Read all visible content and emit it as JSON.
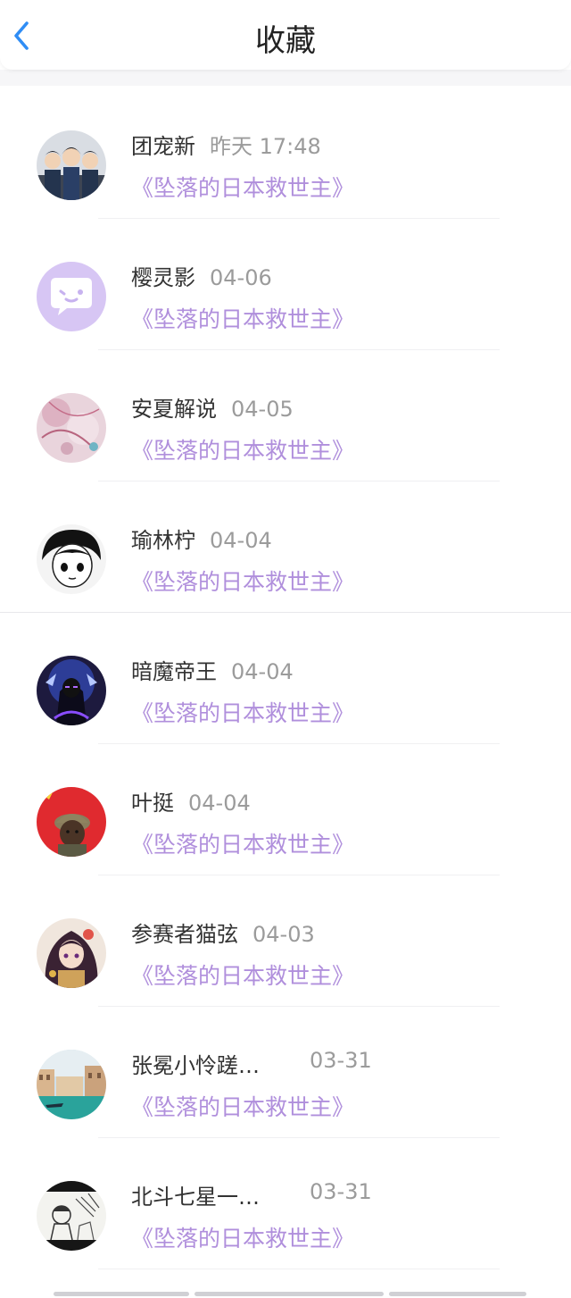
{
  "header": {
    "title": "收藏",
    "back_icon": "chevron-left-icon",
    "accent": "#2f8df5"
  },
  "colors": {
    "work_title": "#b08fdc",
    "timestamp": "#9b9b9b",
    "name": "#333333"
  },
  "items": [
    {
      "name": "团宠新",
      "time": "昨天 17:48",
      "work": "《坠落的日本救世主》",
      "avatar": "anime-trio-avatar"
    },
    {
      "name": "樱灵影",
      "time": "04-06",
      "work": "《坠落的日本救世主》",
      "avatar": "chat-bubble-avatar"
    },
    {
      "name": "安夏解说",
      "time": "04-05",
      "work": "《坠落的日本救世主》",
      "avatar": "pink-abstract-avatar"
    },
    {
      "name": "瑜林柠",
      "time": "04-04",
      "work": "《坠落的日本救世主》",
      "avatar": "manga-boy-avatar"
    },
    {
      "name": "暗魔帝王",
      "time": "04-04",
      "work": "《坠落的日本救世主》",
      "avatar": "dark-warrior-avatar"
    },
    {
      "name": "叶挺",
      "time": "04-04",
      "work": "《坠落的日本救世主》",
      "avatar": "soldier-red-avatar"
    },
    {
      "name": "参赛者猫弦",
      "time": "04-03",
      "work": "《坠落的日本救世主》",
      "avatar": "anime-girl-avatar"
    },
    {
      "name": "张冕小怜蹉…",
      "time": "03-31",
      "work": "《坠落的日本救世主》",
      "avatar": "venice-canal-avatar"
    },
    {
      "name": "北斗七星一…",
      "time": "03-31",
      "work": "《坠落的日本救世主》",
      "avatar": "sketch-avatar"
    }
  ]
}
